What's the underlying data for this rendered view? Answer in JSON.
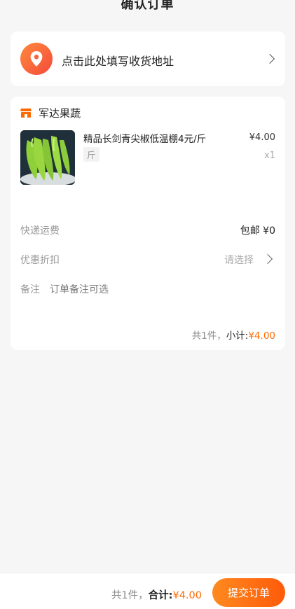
{
  "header": {
    "title": "确认订单"
  },
  "address": {
    "prompt": "点击此处填写收货地址",
    "icon": "location-pin-icon"
  },
  "shop": {
    "name": "军达果蔬",
    "icon": "store-icon",
    "icon_color": "#ff6a00"
  },
  "product": {
    "name": "精品长剑青尖椒低温棚4元/斤",
    "unit": "斤",
    "price": "¥4.00",
    "quantity": "x1"
  },
  "shipping": {
    "label": "快递运费",
    "value": "包邮 ¥0"
  },
  "discount": {
    "label": "优惠折扣",
    "placeholder": "请选择"
  },
  "note": {
    "label": "备注",
    "placeholder": "订单备注可选"
  },
  "subtotal": {
    "count_text": "共1件，",
    "label": "小计:",
    "amount": "¥4.00"
  },
  "footer": {
    "count_text": "共1件，",
    "total_label": "合计:",
    "total_amount": "¥4.00",
    "submit_label": "提交订单"
  },
  "colors": {
    "accent": "#ff6a00",
    "background": "#f6f6f6"
  }
}
